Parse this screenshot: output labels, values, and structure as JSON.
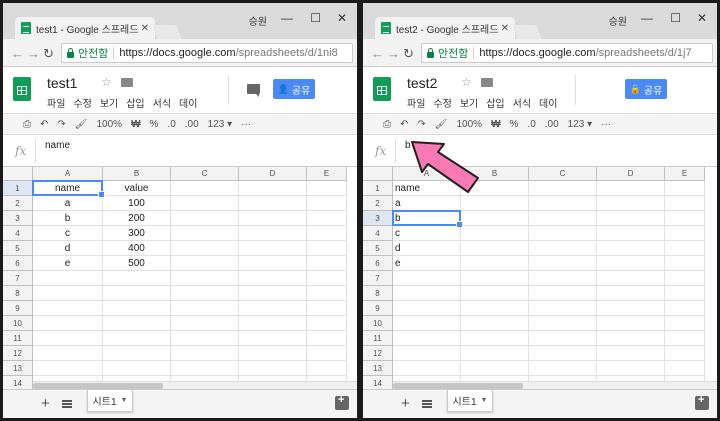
{
  "os": {
    "user": "승원",
    "minimize": "—",
    "maximize": "☐",
    "close": "✕"
  },
  "windows": [
    {
      "id": "left",
      "tab_title": "test1 - Google 스프레드",
      "url_secure": "안전함",
      "url_host": "https://docs.google.com",
      "url_path": "/spreadsheets/d/1ni8",
      "doc_title": "test1",
      "menus": [
        "파일",
        "수정",
        "보기",
        "삽입",
        "서식",
        "데이"
      ],
      "share_label": "공유",
      "share_glyph": "👤",
      "toolbar": {
        "zoom": "100%",
        "currency": "₩",
        "percent": "%",
        "dec_less": ".0",
        "dec_more": ".00",
        "format": "123 ▾",
        "more": "···"
      },
      "formula_value": "name",
      "columns": [
        "A",
        "B",
        "C",
        "D",
        "E"
      ],
      "rows": [
        "1",
        "2",
        "3",
        "4",
        "5",
        "6",
        "7",
        "8",
        "9",
        "10",
        "11",
        "12",
        "13",
        "14"
      ],
      "cells": [
        [
          "name",
          "value"
        ],
        [
          "a",
          "100"
        ],
        [
          "b",
          "200"
        ],
        [
          "c",
          "300"
        ],
        [
          "d",
          "400"
        ],
        [
          "e",
          "500"
        ]
      ],
      "sheet_tab": "시트1"
    },
    {
      "id": "right",
      "tab_title": "test2 - Google 스프레드",
      "url_secure": "안전함",
      "url_host": "https://docs.google.com",
      "url_path": "/spreadsheets/d/1j7",
      "doc_title": "test2",
      "menus": [
        "파일",
        "수정",
        "보기",
        "삽입",
        "서식",
        "데이"
      ],
      "share_label": "공유",
      "share_glyph": "🔒",
      "toolbar": {
        "zoom": "100%",
        "currency": "₩",
        "percent": "%",
        "dec_less": ".0",
        "dec_more": ".00",
        "format": "123 ▾",
        "more": "···"
      },
      "formula_value": "b",
      "columns": [
        "A",
        "B",
        "C",
        "D",
        "E"
      ],
      "rows": [
        "1",
        "2",
        "3",
        "4",
        "5",
        "6",
        "7",
        "8",
        "9",
        "10",
        "11",
        "12",
        "13",
        "14"
      ],
      "cells": [
        [
          "name"
        ],
        [
          "a"
        ],
        [
          "b"
        ],
        [
          "c"
        ],
        [
          "d"
        ],
        [
          "e"
        ]
      ],
      "sheet_tab": "시트1"
    }
  ],
  "colors": {
    "accent": "#4a8af4",
    "sheets_green": "#0f9d58",
    "arrow": "#f879b4"
  }
}
